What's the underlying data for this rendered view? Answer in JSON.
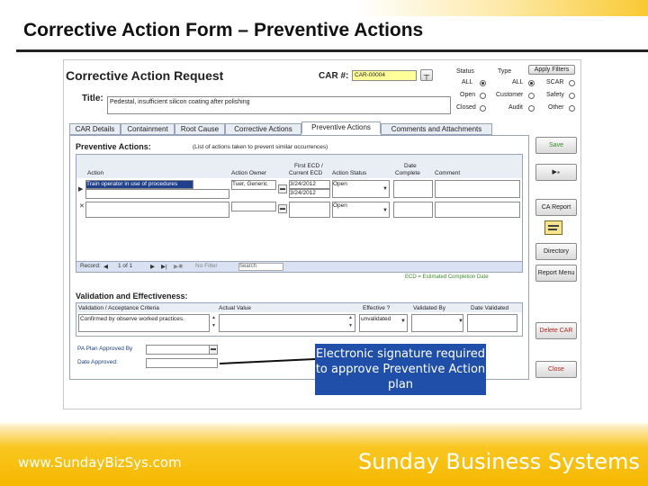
{
  "slide": {
    "title": "Corrective Action Form – Preventive Actions",
    "website": "www.SundayBizSys.com",
    "company": "Sunday Business Systems",
    "callout": "Electronic signature required to approve Preventive Action plan"
  },
  "form": {
    "heading": "Corrective Action Request",
    "car_label": "CAR #:",
    "car_value": "CAR-00004",
    "title_label": "Title:",
    "title_value": "Pedestal, insufficient silicon coating after polishing",
    "status_label": "Status",
    "status_options": [
      "ALL",
      "Open",
      "Closed"
    ],
    "type_label": "Type",
    "type_col1": [
      "ALL",
      "Customer",
      "Audit"
    ],
    "type_col2": [
      "SCAR",
      "Safety",
      "Other"
    ],
    "apply_filters": "Apply Filters"
  },
  "tabs": [
    "CAR Details",
    "Containment",
    "Root Cause",
    "Corrective Actions",
    "Preventive Actions",
    "Comments and Attachments"
  ],
  "preventive": {
    "heading": "Preventive Actions:",
    "hint": "(List of actions taken to prevent similar occurrences)",
    "col_action": "Action",
    "col_owner": "Action Owner",
    "col_first_ecd": "First ECD /",
    "col_current_ecd": "Current ECD",
    "col_status": "Action Status",
    "col_date": "Date",
    "col_complete": "Complete",
    "col_comment": "Comment",
    "rows": [
      {
        "action": "Train operator in use of procedures",
        "owner": "Tuer, Generic",
        "first_ecd": "3/24/2012",
        "current_ecd": "3/24/2012",
        "status": "Open"
      },
      {
        "action": "",
        "owner": "",
        "first_ecd": "",
        "current_ecd": "",
        "status": "Open"
      }
    ],
    "nav_record": "Record:",
    "nav_pos": "1 of 1",
    "nav_filter": "No Filter",
    "nav_search": "Search",
    "ecd_note": "ECD = Estimated Completion Date"
  },
  "validation": {
    "heading": "Validation and Effectiveness:",
    "col_criteria": "Validation / Acceptance Criteria",
    "col_actual": "Actual Value",
    "col_effective": "Effective ?",
    "col_by": "Validated By",
    "col_date": "Date Validated",
    "criteria_value": "Confirmed by observe worked practices.",
    "effective_value": "unvalidated"
  },
  "approval": {
    "approved_by_label": "PA Plan Approved By",
    "date_approved_label": "Date Approved:"
  },
  "side_buttons": [
    "Save",
    "▶⁎",
    "CA Report",
    "",
    "Directory",
    "Report Menu",
    "Delete CAR",
    "Close"
  ],
  "colors": {
    "accent": "#f7bd00",
    "highlight_car": "#ffff99",
    "section_blue": "#9aa4b8",
    "green_text": "#3b8a2a"
  }
}
